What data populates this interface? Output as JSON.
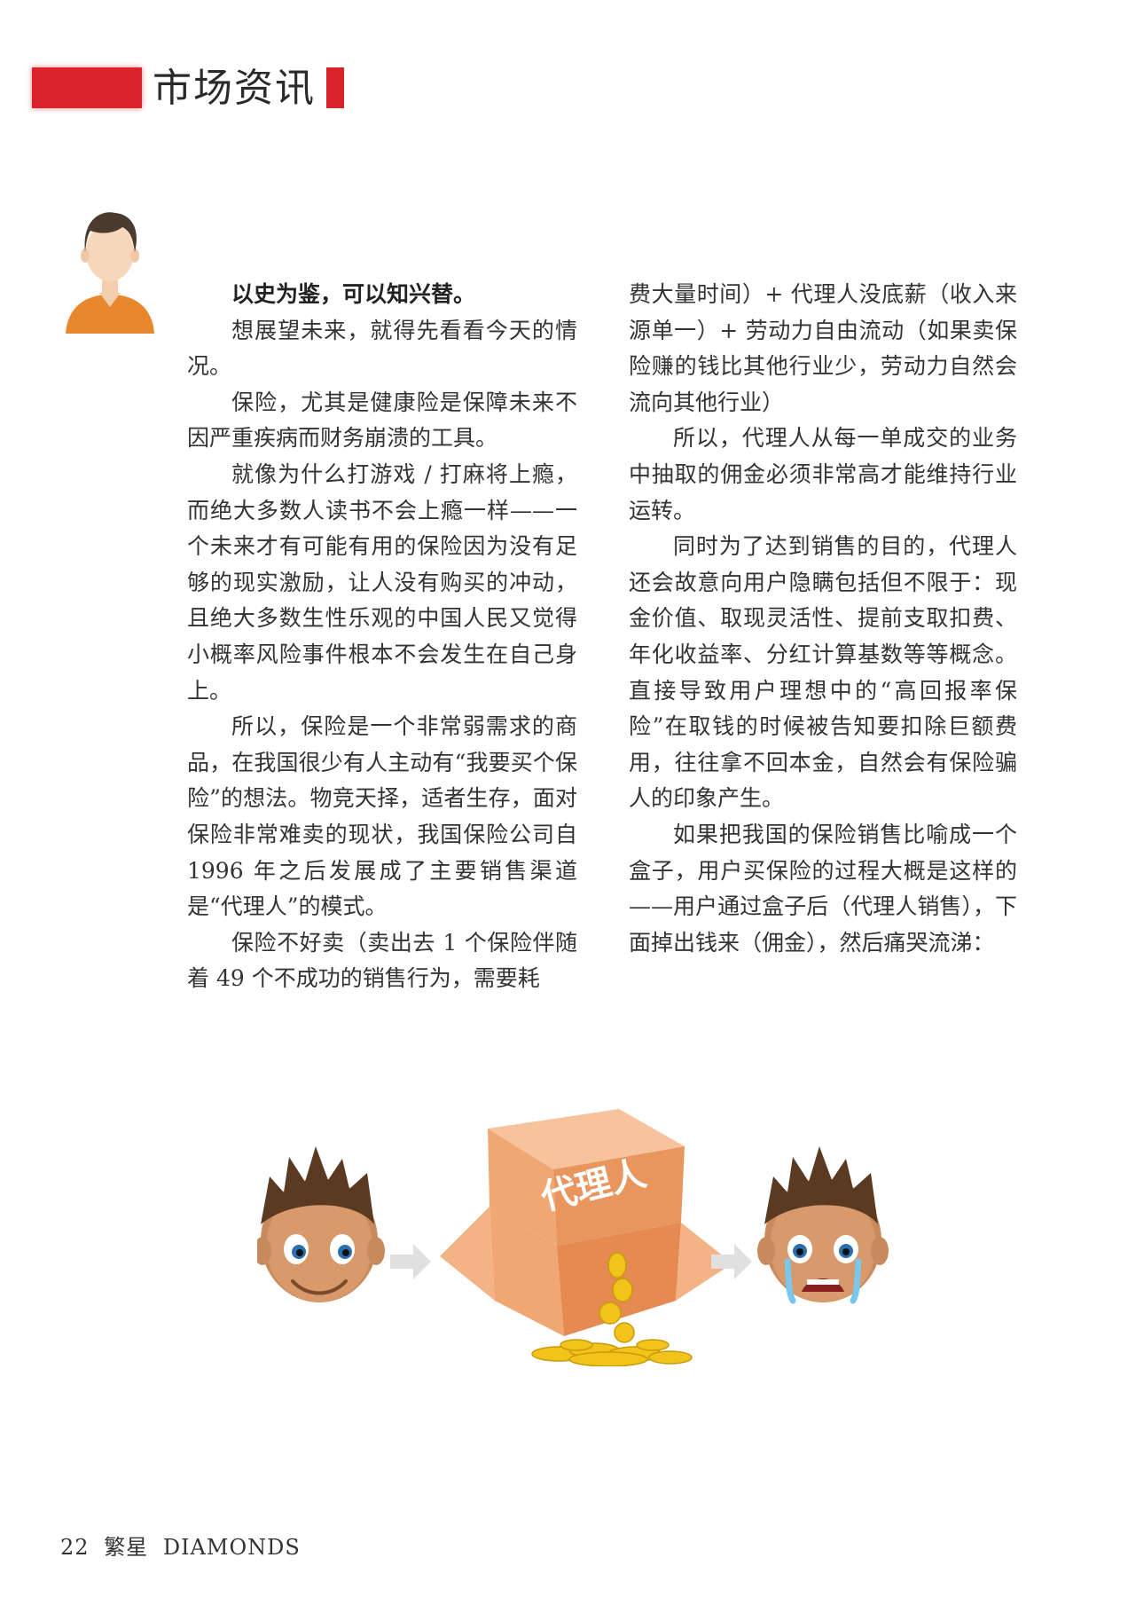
{
  "header": {
    "section_title": "市场资讯"
  },
  "article": {
    "left_column": [
      "以史为鉴，可以知兴替。",
      "想展望未来，就得先看看今天的情况。",
      "保险，尤其是健康险是保障未来不因严重疾病而财务崩溃的工具。",
      "就像为什么打游戏 / 打麻将上瘾，而绝大多数人读书不会上瘾一样——一个未来才有可能有用的保险因为没有足够的现实激励，让人没有购买的冲动，且绝大多数生性乐观的中国人民又觉得小概率风险事件根本不会发生在自己身上。",
      "所以，保险是一个非常弱需求的商品，在我国很少有人主动有“我要买个保险”的想法。物竞天择，适者生存，面对保险非常难卖的现状，我国保险公司自 1996 年之后发展成了主要销售渠道是“代理人”的模式。",
      "保险不好卖（卖出去 1 个保险伴随着 49 个不成功的销售行为，需要耗"
    ],
    "right_column": [
      "费大量时间）+ 代理人没底薪（收入来源单一）+ 劳动力自由流动（如果卖保险赚的钱比其他行业少，劳动力自然会流向其他行业）",
      "所以，代理人从每一单成交的业务中抽取的佣金必须非常高才能维持行业运转。",
      "同时为了达到销售的目的，代理人还会故意向用户隐瞒包括但不限于：现金价值、取现灵活性、提前支取扣费、年化收益率、分红计算基数等等概念。直接导致用户理想中的“高回报率保险”在取钱的时候被告知要扣除巨额费用，往往拿不回本金，自然会有保险骗人的印象产生。",
      "如果把我国的保险销售比喻成一个盒子，用户买保险的过程大概是这样的——用户通过盒子后（代理人销售），下面掉出钱来（佣金），然后痛哭流涕："
    ]
  },
  "illustration": {
    "box_label": "代理人"
  },
  "footer": {
    "page_number": "22",
    "brand_cn": "繁星",
    "brand_en": "DIAMONDS"
  },
  "colors": {
    "accent_red": "#d8232a",
    "box_orange": "#f0a773",
    "coin_gold": "#f2c31b",
    "shirt_orange": "#e8872c",
    "hair_brown": "#5b3a22"
  }
}
